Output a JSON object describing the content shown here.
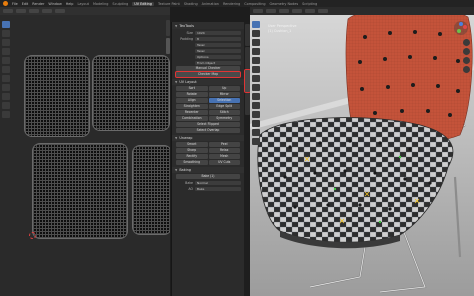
{
  "topbar": {
    "menus": [
      "File",
      "Edit",
      "Render",
      "Window",
      "Help"
    ],
    "workspaces": [
      "Layout",
      "Modeling",
      "Sculpting",
      "UV Editing",
      "Texture Paint",
      "Shading",
      "Animation",
      "Rendering",
      "Compositing",
      "Geometry Nodes",
      "Scripting"
    ],
    "active_workspace": "UV Editing"
  },
  "uv_editor": {
    "tool_icons": [
      "select-icon",
      "cursor-icon",
      "move-icon",
      "rotate-icon",
      "scale-icon",
      "transform-icon",
      "annotate-icon",
      "grab-icon",
      "relax-icon",
      "pinch-icon",
      "sample-icon"
    ]
  },
  "panel": {
    "title": "TexTools",
    "size_label": "Size",
    "size_value": "1024",
    "padding_label": "Padding",
    "padding_value": "8",
    "mode_value": "Texel",
    "mode2_value": "Texel",
    "options_value": "Options",
    "bake_value": "From Object",
    "btn_manual": "Manual Checker",
    "btn_checker": "Checker Map",
    "uv_layout_title": "UV Layout",
    "btn_sort": "Sort",
    "btn_up": "Up",
    "btn_rotate": "Rotate",
    "btn_mirror": "Mirror",
    "btn_align": "Align",
    "btn_selection": "Selection",
    "btn_straighten": "Straighten",
    "btn_edge_split": "Edge Split",
    "btn_recenter": "Recenter",
    "btn_stitch": "Stitch",
    "btn_combination": "Combination",
    "btn_symmetry": "Symmetry",
    "btn_select_flipped": "Select Flipped",
    "btn_select_overlap": "Select Overlap",
    "unwrap": "Unwrap",
    "btn_smart": "Smart",
    "btn_peel": "Peel",
    "btn_sharp": "Sharp",
    "btn_relax": "Relax",
    "btn_rectify": "Rectify",
    "btn_mesh": "Mesh",
    "btn_uv_smoothing": "Smoothing",
    "btn_uv_cuts": "UV Cuts",
    "baking_title": "Baking",
    "btn_bake": "Bake (1)",
    "label_mode": "Bake",
    "label_ao": "AO",
    "btn_bake_ao": "Bake",
    "btn_normal": "Normal"
  },
  "viewport": {
    "perspective": "User Perspective",
    "object": "(1) Cushion_1"
  },
  "colors": {
    "active_red": "#e03535",
    "accent_blue": "#4772b3",
    "seat_leather": "#c4533a"
  }
}
